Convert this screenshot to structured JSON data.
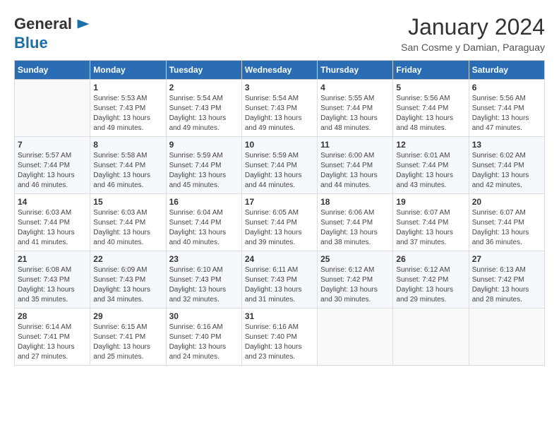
{
  "header": {
    "logo_line1": "General",
    "logo_line2": "Blue",
    "month_title": "January 2024",
    "subtitle": "San Cosme y Damian, Paraguay"
  },
  "days_of_week": [
    "Sunday",
    "Monday",
    "Tuesday",
    "Wednesday",
    "Thursday",
    "Friday",
    "Saturday"
  ],
  "weeks": [
    [
      {
        "day": "",
        "info": ""
      },
      {
        "day": "1",
        "info": "Sunrise: 5:53 AM\nSunset: 7:43 PM\nDaylight: 13 hours\nand 49 minutes."
      },
      {
        "day": "2",
        "info": "Sunrise: 5:54 AM\nSunset: 7:43 PM\nDaylight: 13 hours\nand 49 minutes."
      },
      {
        "day": "3",
        "info": "Sunrise: 5:54 AM\nSunset: 7:43 PM\nDaylight: 13 hours\nand 49 minutes."
      },
      {
        "day": "4",
        "info": "Sunrise: 5:55 AM\nSunset: 7:44 PM\nDaylight: 13 hours\nand 48 minutes."
      },
      {
        "day": "5",
        "info": "Sunrise: 5:56 AM\nSunset: 7:44 PM\nDaylight: 13 hours\nand 48 minutes."
      },
      {
        "day": "6",
        "info": "Sunrise: 5:56 AM\nSunset: 7:44 PM\nDaylight: 13 hours\nand 47 minutes."
      }
    ],
    [
      {
        "day": "7",
        "info": "Sunrise: 5:57 AM\nSunset: 7:44 PM\nDaylight: 13 hours\nand 46 minutes."
      },
      {
        "day": "8",
        "info": "Sunrise: 5:58 AM\nSunset: 7:44 PM\nDaylight: 13 hours\nand 46 minutes."
      },
      {
        "day": "9",
        "info": "Sunrise: 5:59 AM\nSunset: 7:44 PM\nDaylight: 13 hours\nand 45 minutes."
      },
      {
        "day": "10",
        "info": "Sunrise: 5:59 AM\nSunset: 7:44 PM\nDaylight: 13 hours\nand 44 minutes."
      },
      {
        "day": "11",
        "info": "Sunrise: 6:00 AM\nSunset: 7:44 PM\nDaylight: 13 hours\nand 44 minutes."
      },
      {
        "day": "12",
        "info": "Sunrise: 6:01 AM\nSunset: 7:44 PM\nDaylight: 13 hours\nand 43 minutes."
      },
      {
        "day": "13",
        "info": "Sunrise: 6:02 AM\nSunset: 7:44 PM\nDaylight: 13 hours\nand 42 minutes."
      }
    ],
    [
      {
        "day": "14",
        "info": "Sunrise: 6:03 AM\nSunset: 7:44 PM\nDaylight: 13 hours\nand 41 minutes."
      },
      {
        "day": "15",
        "info": "Sunrise: 6:03 AM\nSunset: 7:44 PM\nDaylight: 13 hours\nand 40 minutes."
      },
      {
        "day": "16",
        "info": "Sunrise: 6:04 AM\nSunset: 7:44 PM\nDaylight: 13 hours\nand 40 minutes."
      },
      {
        "day": "17",
        "info": "Sunrise: 6:05 AM\nSunset: 7:44 PM\nDaylight: 13 hours\nand 39 minutes."
      },
      {
        "day": "18",
        "info": "Sunrise: 6:06 AM\nSunset: 7:44 PM\nDaylight: 13 hours\nand 38 minutes."
      },
      {
        "day": "19",
        "info": "Sunrise: 6:07 AM\nSunset: 7:44 PM\nDaylight: 13 hours\nand 37 minutes."
      },
      {
        "day": "20",
        "info": "Sunrise: 6:07 AM\nSunset: 7:44 PM\nDaylight: 13 hours\nand 36 minutes."
      }
    ],
    [
      {
        "day": "21",
        "info": "Sunrise: 6:08 AM\nSunset: 7:43 PM\nDaylight: 13 hours\nand 35 minutes."
      },
      {
        "day": "22",
        "info": "Sunrise: 6:09 AM\nSunset: 7:43 PM\nDaylight: 13 hours\nand 34 minutes."
      },
      {
        "day": "23",
        "info": "Sunrise: 6:10 AM\nSunset: 7:43 PM\nDaylight: 13 hours\nand 32 minutes."
      },
      {
        "day": "24",
        "info": "Sunrise: 6:11 AM\nSunset: 7:43 PM\nDaylight: 13 hours\nand 31 minutes."
      },
      {
        "day": "25",
        "info": "Sunrise: 6:12 AM\nSunset: 7:42 PM\nDaylight: 13 hours\nand 30 minutes."
      },
      {
        "day": "26",
        "info": "Sunrise: 6:12 AM\nSunset: 7:42 PM\nDaylight: 13 hours\nand 29 minutes."
      },
      {
        "day": "27",
        "info": "Sunrise: 6:13 AM\nSunset: 7:42 PM\nDaylight: 13 hours\nand 28 minutes."
      }
    ],
    [
      {
        "day": "28",
        "info": "Sunrise: 6:14 AM\nSunset: 7:41 PM\nDaylight: 13 hours\nand 27 minutes."
      },
      {
        "day": "29",
        "info": "Sunrise: 6:15 AM\nSunset: 7:41 PM\nDaylight: 13 hours\nand 25 minutes."
      },
      {
        "day": "30",
        "info": "Sunrise: 6:16 AM\nSunset: 7:40 PM\nDaylight: 13 hours\nand 24 minutes."
      },
      {
        "day": "31",
        "info": "Sunrise: 6:16 AM\nSunset: 7:40 PM\nDaylight: 13 hours\nand 23 minutes."
      },
      {
        "day": "",
        "info": ""
      },
      {
        "day": "",
        "info": ""
      },
      {
        "day": "",
        "info": ""
      }
    ]
  ]
}
